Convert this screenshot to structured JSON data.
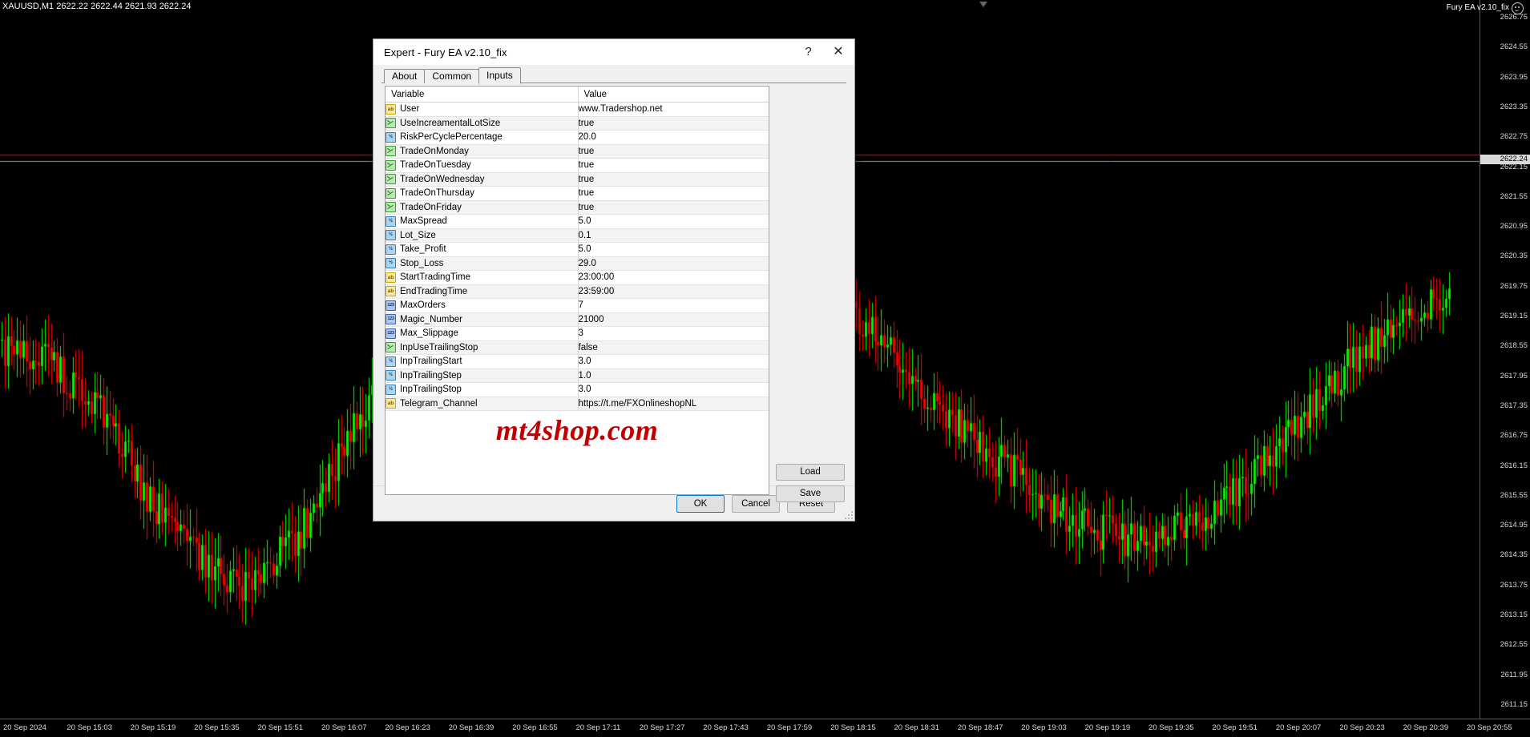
{
  "chart": {
    "symbol_label": "XAUUSD,M1   2622.22 2622.44 2621.93 2622.24",
    "ea_label": "Fury EA v2.10_fix",
    "current_price_tag": "2622.24",
    "price_ticks": [
      "2626.75",
      "2624.55",
      "2623.95",
      "2623.35",
      "2622.75",
      "2622.15",
      "2621.55",
      "2620.95",
      "2620.35",
      "2619.75",
      "2619.15",
      "2618.55",
      "2617.95",
      "2617.35",
      "2616.75",
      "2616.15",
      "2615.55",
      "2614.95",
      "2614.35",
      "2613.75",
      "2613.15",
      "2612.55",
      "2611.95",
      "2611.15"
    ],
    "time_ticks": [
      "20 Sep 2024",
      "20 Sep 15:03",
      "20 Sep 15:19",
      "20 Sep 15:35",
      "20 Sep 15:51",
      "20 Sep 16:07",
      "20 Sep 16:23",
      "20 Sep 16:39",
      "20 Sep 16:55",
      "20 Sep 17:11",
      "20 Sep 17:27",
      "20 Sep 17:43",
      "20 Sep 17:59",
      "20 Sep 18:15",
      "20 Sep 18:31",
      "20 Sep 18:47",
      "20 Sep 19:03",
      "20 Sep 19:19",
      "20 Sep 19:35",
      "20 Sep 19:51",
      "20 Sep 20:07",
      "20 Sep 20:23",
      "20 Sep 20:39",
      "20 Sep 20:55"
    ],
    "colors": {
      "bull": "#00ff00",
      "bear": "#ff0000",
      "background": "#000000",
      "price_line": "#ff0000",
      "grid": "#5a5a5a"
    }
  },
  "dialog": {
    "title": "Expert - Fury EA v2.10_fix",
    "help_button": "?",
    "close_button": "✕",
    "tabs": [
      {
        "label": "About",
        "active": false
      },
      {
        "label": "Common",
        "active": false
      },
      {
        "label": "Inputs",
        "active": true
      }
    ],
    "table": {
      "headers": {
        "variable": "Variable",
        "value": "Value"
      },
      "rows": [
        {
          "icon": "string-icon",
          "type": "str",
          "variable": "User",
          "value": "www.Tradershop.net"
        },
        {
          "icon": "boolean-icon",
          "type": "bool",
          "variable": "UseIncreamentalLotSize",
          "value": "true"
        },
        {
          "icon": "double-icon",
          "type": "dbl",
          "variable": "RiskPerCyclePercentage",
          "value": "20.0"
        },
        {
          "icon": "boolean-icon",
          "type": "bool",
          "variable": "TradeOnMonday",
          "value": "true"
        },
        {
          "icon": "boolean-icon",
          "type": "bool",
          "variable": "TradeOnTuesday",
          "value": "true"
        },
        {
          "icon": "boolean-icon",
          "type": "bool",
          "variable": "TradeOnWednesday",
          "value": "true"
        },
        {
          "icon": "boolean-icon",
          "type": "bool",
          "variable": "TradeOnThursday",
          "value": "true"
        },
        {
          "icon": "boolean-icon",
          "type": "bool",
          "variable": "TradeOnFriday",
          "value": "true"
        },
        {
          "icon": "double-icon",
          "type": "dbl",
          "variable": "MaxSpread",
          "value": "5.0"
        },
        {
          "icon": "double-icon",
          "type": "dbl",
          "variable": "Lot_Size",
          "value": "0.1"
        },
        {
          "icon": "double-icon",
          "type": "dbl",
          "variable": "Take_Profit",
          "value": "5.0"
        },
        {
          "icon": "double-icon",
          "type": "dbl",
          "variable": "Stop_Loss",
          "value": "29.0"
        },
        {
          "icon": "string-icon",
          "type": "str",
          "variable": "StartTradingTime",
          "value": "23:00:00"
        },
        {
          "icon": "string-icon",
          "type": "str",
          "variable": "EndTradingTime",
          "value": "23:59:00"
        },
        {
          "icon": "integer-icon",
          "type": "int",
          "variable": "MaxOrders",
          "value": "7"
        },
        {
          "icon": "integer-icon",
          "type": "int",
          "variable": "Magic_Number",
          "value": "21000"
        },
        {
          "icon": "integer-icon",
          "type": "int",
          "variable": "Max_Slippage",
          "value": "3"
        },
        {
          "icon": "boolean-icon",
          "type": "bool",
          "variable": "InpUseTrailingStop",
          "value": "false"
        },
        {
          "icon": "double-icon",
          "type": "dbl",
          "variable": "InpTrailingStart",
          "value": "3.0"
        },
        {
          "icon": "double-icon",
          "type": "dbl",
          "variable": "InpTrailingStep",
          "value": "1.0"
        },
        {
          "icon": "double-icon",
          "type": "dbl",
          "variable": "InpTrailingStop",
          "value": "3.0"
        },
        {
          "icon": "string-icon",
          "type": "str",
          "variable": "Telegram_Channel",
          "value": "https://t.me/FXOnlineshopNL"
        }
      ]
    },
    "watermark": "mt4shop.com",
    "side_buttons": {
      "load": "Load",
      "save": "Save"
    },
    "footer_buttons": {
      "ok": "OK",
      "cancel": "Cancel",
      "reset": "Reset"
    },
    "icon_glyphs": {
      "str": "ab",
      "dbl": "½",
      "int": "123"
    }
  }
}
